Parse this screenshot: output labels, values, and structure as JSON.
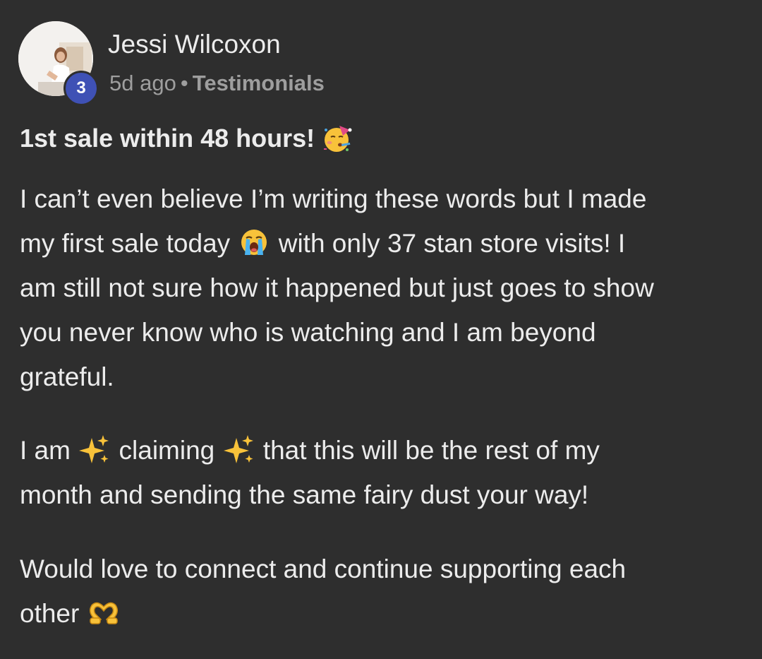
{
  "author": {
    "name": "Jessi Wilcoxon",
    "level": "3",
    "avatar_icon": "profile-photo"
  },
  "meta": {
    "time": "5d ago",
    "separator": "•",
    "category": "Testimonials"
  },
  "post": {
    "title": "1st sale within 48 hours!",
    "title_emoji": "partying-face-icon",
    "p1_line1": "I can’t even believe I’m writing these words but I made",
    "p1_line2_a": "my first sale today",
    "p1_emoji": "loudly-crying-face-icon",
    "p1_line2_b": "with only 37 stan store visits! I",
    "p1_line3": "am still not sure how it happened but just goes to show",
    "p1_line4": "you never know who is watching and I am beyond",
    "p1_line5": "grateful.",
    "p2_a": "I am",
    "p2_b": "claiming",
    "p2_c": "that this will be the rest of my",
    "p2_line2": "month and sending the same fairy dust your way!",
    "p2_emoji": "sparkles-icon",
    "p3_line1": "Would love to connect and continue supporting each",
    "p3_line2": "other",
    "p3_emoji": "heart-hands-icon"
  },
  "colors": {
    "background": "#2e2e2e",
    "text": "#ececec",
    "muted": "#9e9e9e",
    "badge": "#3f51b5"
  }
}
